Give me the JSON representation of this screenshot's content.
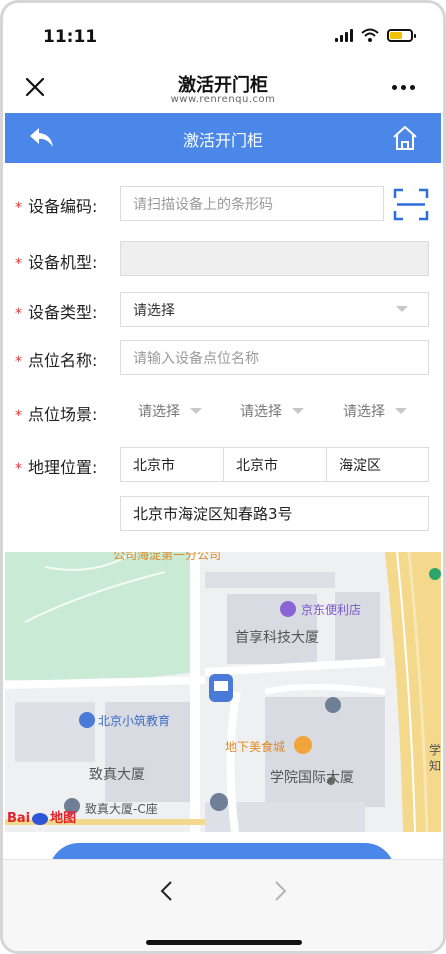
{
  "status_bar": {
    "time": "11:11"
  },
  "browser": {
    "title": "激活开门柜",
    "url": "www.renrenqu.com",
    "close_icon": "close-icon",
    "more_icon": "more-icon"
  },
  "app_bar": {
    "title": "激活开门柜",
    "back_icon": "back-arrow-icon",
    "home_icon": "home-icon",
    "color": "#4a87e8"
  },
  "form": {
    "required_mark": "*",
    "device_code": {
      "label": "设备编码:",
      "placeholder": "请扫描设备上的条形码",
      "scan_icon": "scan-icon"
    },
    "device_model": {
      "label": "设备机型:",
      "value": ""
    },
    "device_type": {
      "label": "设备类型:",
      "value": "请选择"
    },
    "location_name": {
      "label": "点位名称:",
      "placeholder": "请输入设备点位名称"
    },
    "location_scene": {
      "label": "点位场景:",
      "options": [
        "请选择",
        "请选择",
        "请选择"
      ]
    },
    "geo_location": {
      "label": "地理位置:",
      "province": "北京市",
      "city": "北京市",
      "district": "海淀区",
      "address": "北京市海淀区知春路3号"
    }
  },
  "map": {
    "labels": {
      "top_partial": "公司海淀第一分公司",
      "store": "京东便利店",
      "tech_building": "首享科技大厦",
      "education": "北京小筑教育",
      "food_court": "地下美食城",
      "zhizhen": "致真大厦",
      "zhizhen_c": "致真大厦-C座",
      "academy": "学院国际大厦",
      "edge_partial": "学知"
    },
    "logo": {
      "brand": "Bai",
      "brand2": "地图"
    }
  },
  "bottom": {
    "nav_back_icon": "chevron-left-icon",
    "nav_forward_icon": "chevron-right-icon"
  }
}
